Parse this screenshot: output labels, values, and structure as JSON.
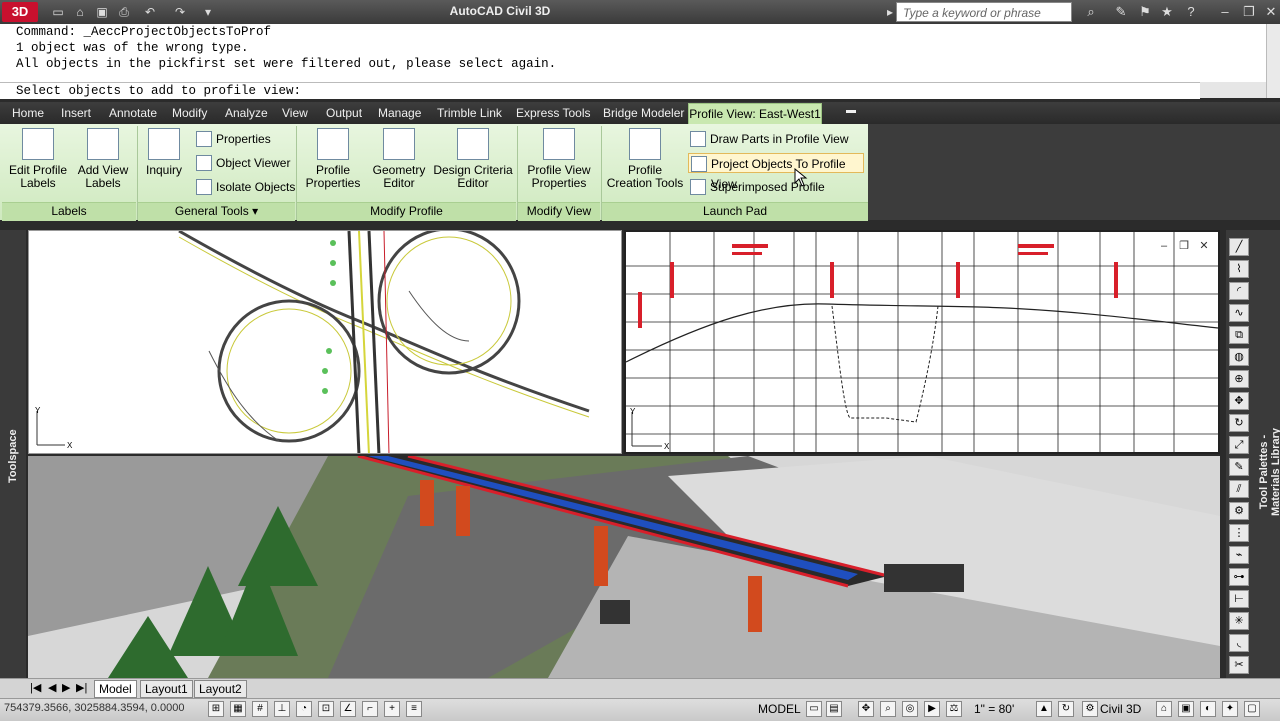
{
  "window": {
    "title": "AutoCAD Civil 3D",
    "logo_text": "3D",
    "search_placeholder": "Type a keyword or phrase"
  },
  "command": {
    "lines": [
      "Command: _AeccProjectObjectsToProf",
      "1 object was of the wrong type.",
      "All objects in the pickfirst set were filtered out, please select again."
    ],
    "prompt": "Select objects to add to profile view:"
  },
  "ribbon": {
    "tabs": [
      "Home",
      "Insert",
      "Annotate",
      "Modify",
      "Analyze",
      "View",
      "Output",
      "Manage",
      "Trimble Link",
      "Express Tools",
      "Bridge Modeler"
    ],
    "active_tab": "Profile View: East-West1",
    "panels": {
      "labels": {
        "title": "Labels",
        "edit_profile_labels": "Edit Profile Labels",
        "add_view_labels": "Add View Labels"
      },
      "general_tools": {
        "title": "General Tools",
        "inquiry": "Inquiry",
        "properties": "Properties",
        "object_viewer": "Object Viewer",
        "isolate_objects": "Isolate Objects"
      },
      "modify_profile": {
        "title": "Modify Profile",
        "profile_properties": "Profile Properties",
        "geometry_editor": "Geometry Editor",
        "design_criteria_editor": "Design Criteria Editor"
      },
      "modify_view": {
        "title": "Modify View",
        "profile_view_properties": "Profile View Properties"
      },
      "launch_pad": {
        "title": "Launch Pad",
        "profile_creation_tools": "Profile Creation Tools",
        "draw_parts": "Draw Parts in Profile View",
        "project_objects": "Project Objects To Profile View",
        "superimposed_profile": "Superimposed Profile"
      }
    }
  },
  "side": {
    "toolspace_label": "Toolspace",
    "palette_label": "Tool Palettes - Materials Library"
  },
  "layout_tabs": [
    "Model",
    "Layout1",
    "Layout2"
  ],
  "status": {
    "coords": "754379.3566, 3025884.3594, 0.0000",
    "model_label": "MODEL",
    "scale": "1\" = 80'",
    "workspace": "Civil 3D"
  },
  "colors": {
    "ribbon_green": "#cfe9bf",
    "active_tab": "#c9e8b0",
    "profile_red": "#d81f2a"
  }
}
